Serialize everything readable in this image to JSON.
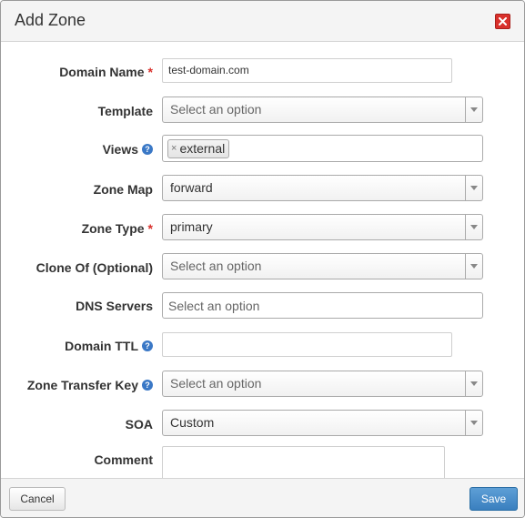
{
  "dialog": {
    "title": "Add Zone",
    "close_icon": "close-icon",
    "accent_color": "#d9302b"
  },
  "form": {
    "domain_name": {
      "label": "Domain Name",
      "required": "*",
      "value": "test-domain.com"
    },
    "template": {
      "label": "Template",
      "placeholder": "Select an option"
    },
    "views": {
      "label": "Views",
      "help": "?",
      "tags": [
        "external"
      ],
      "remove_icon": "×"
    },
    "zone_map": {
      "label": "Zone Map",
      "value": "forward"
    },
    "zone_type": {
      "label": "Zone Type",
      "required": "*",
      "value": "primary"
    },
    "clone_of": {
      "label": "Clone Of (Optional)",
      "placeholder": "Select an option"
    },
    "dns_servers": {
      "label": "DNS Servers",
      "placeholder": "Select an option"
    },
    "domain_ttl": {
      "label": "Domain TTL",
      "help": "?",
      "value": ""
    },
    "zone_transfer_key": {
      "label": "Zone Transfer Key",
      "help": "?",
      "placeholder": "Select an option"
    },
    "soa": {
      "label": "SOA",
      "value": "Custom"
    },
    "comment": {
      "label": "Comment",
      "value": ""
    }
  },
  "footer": {
    "cancel_label": "Cancel",
    "save_label": "Save",
    "save_color": "#3a7fbf"
  }
}
